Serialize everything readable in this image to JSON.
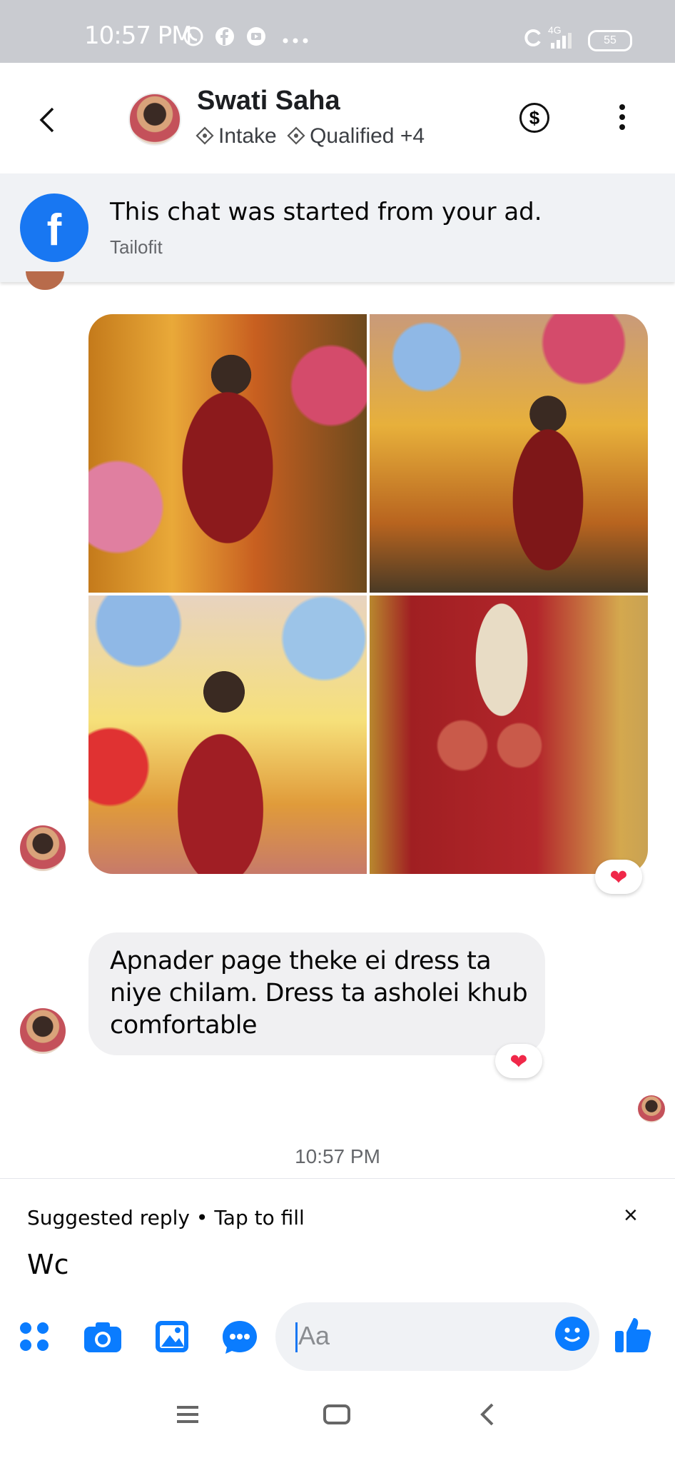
{
  "status_bar": {
    "time": "10:57 PM",
    "network": "4G",
    "battery": "55"
  },
  "header": {
    "contact_name": "Swati Saha",
    "label_1": "Intake",
    "label_2": "Qualified",
    "more_labels": "+4",
    "dollar_symbol": "$"
  },
  "ad_banner": {
    "title": "This chat was started from your ad.",
    "page_name": "Tailofit",
    "logo_letter": "f"
  },
  "messages": {
    "text_message": "Apnader page theke ei dress ta niye chilam. Dress ta asholei khub comfortable",
    "timestamp": "10:57 PM"
  },
  "suggested_reply": {
    "label": "Suggested reply • Tap to fill",
    "reply_text": "Wc",
    "close_symbol": "×"
  },
  "composer": {
    "placeholder": "Aa"
  },
  "colors": {
    "messenger_blue": "#0a7cff",
    "facebook_blue": "#1877f2",
    "heart_red": "#f02849"
  }
}
